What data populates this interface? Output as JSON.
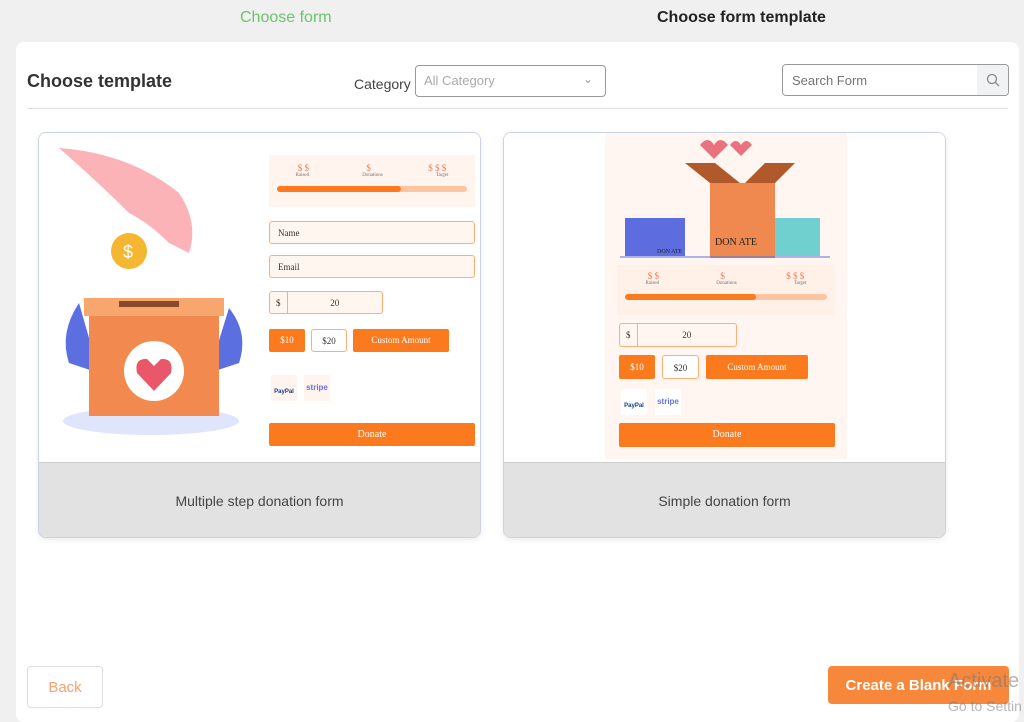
{
  "steps": {
    "step1": "Choose form",
    "step2": "Choose form template"
  },
  "header": {
    "title": "Choose template",
    "category_label": "Category",
    "category_value": "All Category",
    "search_placeholder": "Search Form"
  },
  "templates": [
    {
      "name": "Multiple step donation form",
      "preview": {
        "stats": [
          "$ $",
          "$",
          "$ $ $"
        ],
        "stat_labels": [
          "Raised",
          "Donations",
          "Target"
        ],
        "progress": 0.65,
        "name_field": "Name",
        "email_field": "Email",
        "currency": "$",
        "amount": "20",
        "amounts": [
          "$10",
          "$20",
          "Custom Amount"
        ],
        "payments": [
          "PayPal",
          "stripe"
        ],
        "donate": "Donate"
      }
    },
    {
      "name": "Simple donation form",
      "preview": {
        "box_label": "DON ATE",
        "small_box_label": "DON ATE",
        "stats": [
          "$ $",
          "$",
          "$ $ $"
        ],
        "stat_labels": [
          "Raised",
          "Donations",
          "Target"
        ],
        "progress": 0.65,
        "currency": "$",
        "amount": "20",
        "amounts": [
          "$10",
          "$20",
          "Custom Amount"
        ],
        "payments": [
          "PayPal",
          "stripe"
        ],
        "donate": "Donate"
      }
    }
  ],
  "footer": {
    "back": "Back",
    "create_blank": "Create a Blank Form"
  },
  "watermark": {
    "line1": "Activate",
    "line2": "Go to Settin"
  },
  "colors": {
    "accent": "#f7873b",
    "step_done": "#6cc36a"
  }
}
